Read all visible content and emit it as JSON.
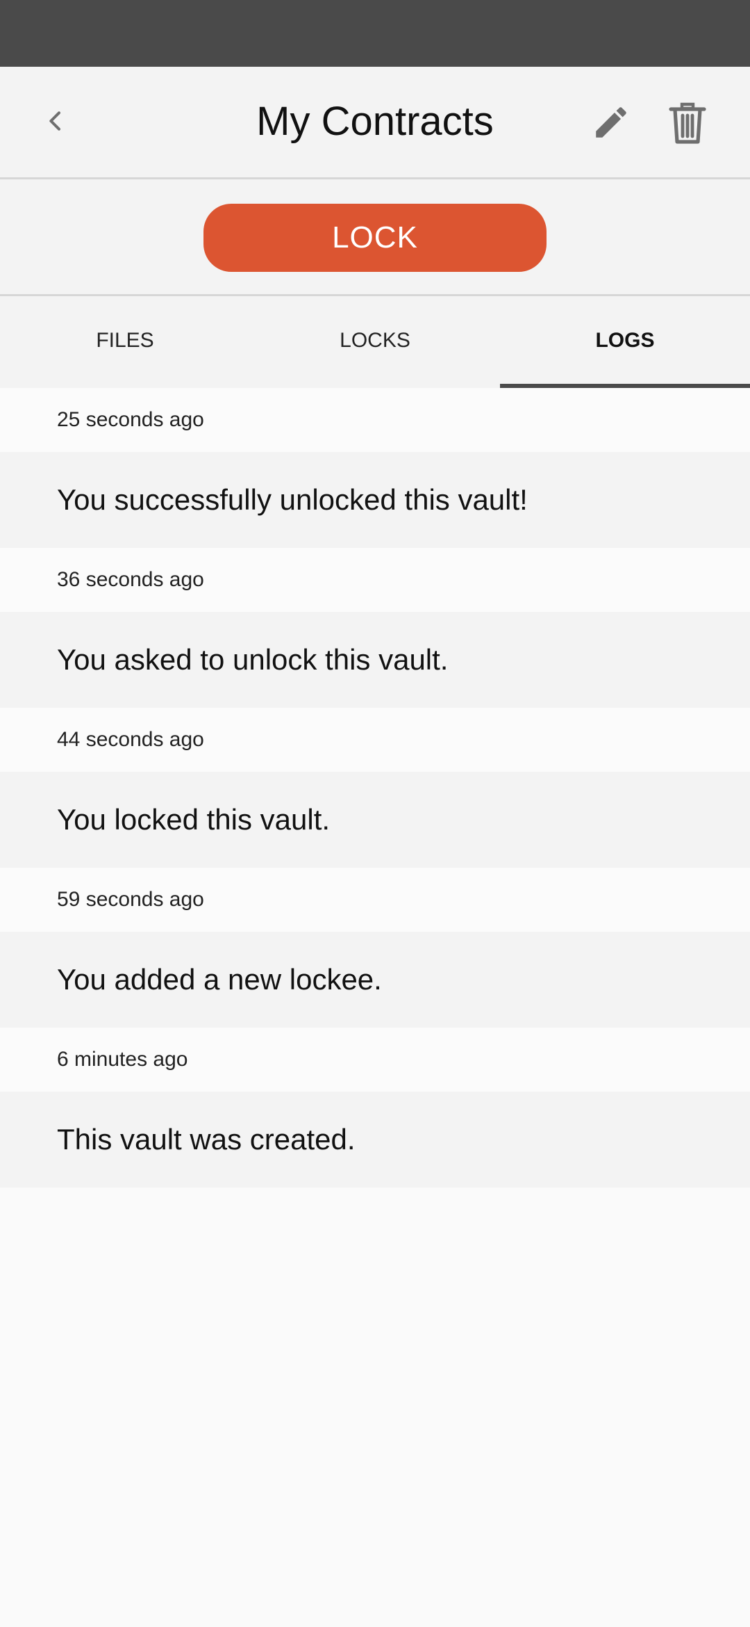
{
  "app_bar": {
    "title": "My Contracts",
    "icons": {
      "back": "chevron-left-icon",
      "edit": "pencil-icon",
      "delete": "trash-icon"
    }
  },
  "lock_button": {
    "label": "LOCK",
    "color": "#dc5531"
  },
  "tabs": [
    {
      "label": "FILES",
      "active": false
    },
    {
      "label": "LOCKS",
      "active": false
    },
    {
      "label": "LOGS",
      "active": true
    }
  ],
  "logs": [
    {
      "time": "25 seconds ago",
      "message": "You successfully unlocked this vault!"
    },
    {
      "time": "36 seconds ago",
      "message": "You asked to unlock this vault."
    },
    {
      "time": "44 seconds ago",
      "message": "You locked this vault."
    },
    {
      "time": "59 seconds ago",
      "message": "You added a new lockee."
    },
    {
      "time": "6 minutes ago",
      "message": "This vault was created."
    }
  ]
}
